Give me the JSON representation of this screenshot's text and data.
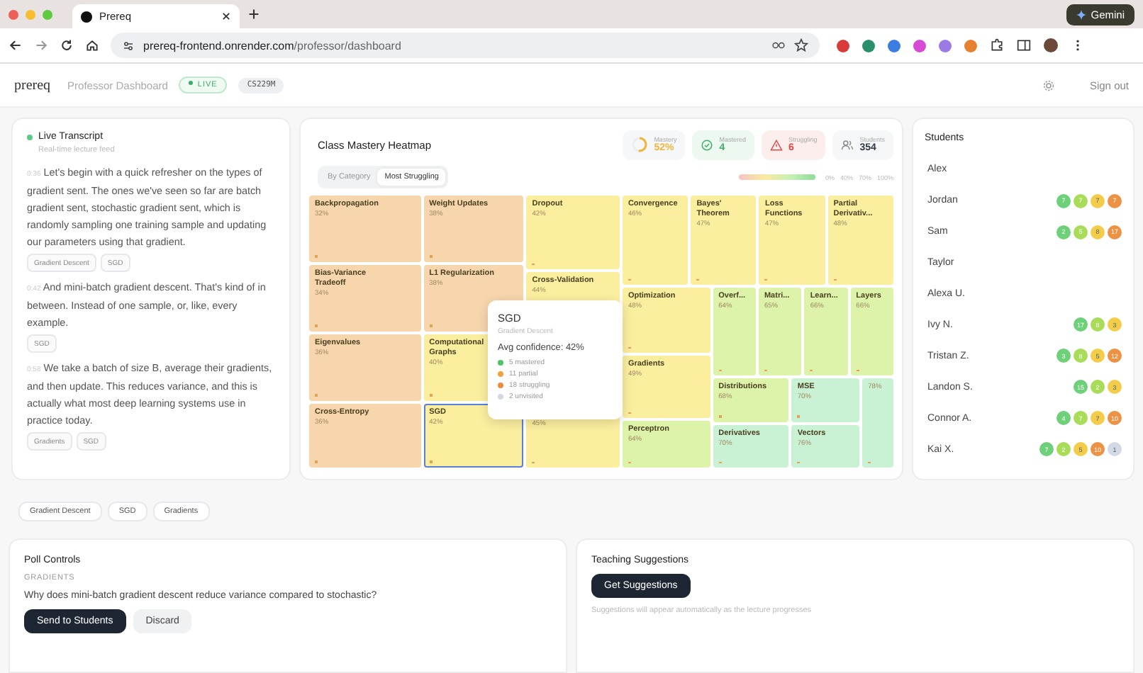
{
  "browser": {
    "tab_title": "Prereq",
    "url_domain": "prereq-frontend.onrender.com",
    "url_path": "/professor/dashboard",
    "gemini": "Gemini"
  },
  "header": {
    "logo": "prereq",
    "title": "Professor Dashboard",
    "live": "LIVE",
    "course": "CS229M",
    "sign_out": "Sign out"
  },
  "transcript": {
    "title": "Live Transcript",
    "subtitle": "Real-time lecture feed",
    "entries": [
      {
        "time": "0:36",
        "text": "Let's begin with a quick refresher on the types of gradient sent. The ones we've seen so far are batch gradient sent, stochastic gradient sent, which is randomly sampling one training sample and updating our parameters using that gradient.",
        "tags": [
          "Gradient Descent",
          "SGD"
        ]
      },
      {
        "time": "0:42",
        "text": "And mini-batch gradient descent. That's kind of in between. Instead of one sample, or, like, every example.",
        "tags": [
          "SGD"
        ]
      },
      {
        "time": "0:58",
        "text": "We take a batch of size B, average their gradients, and then update. This reduces variance, and this is actually what most deep learning systems use in practice today.",
        "tags": [
          "Gradients",
          "SGD"
        ]
      }
    ]
  },
  "heatmap": {
    "title": "Class Mastery Heatmap",
    "stats": [
      {
        "kind": "ring",
        "label": "Mastery",
        "value": "52%",
        "level": 0.52
      },
      {
        "kind": "mastered",
        "label": "Mastered",
        "value": "4"
      },
      {
        "kind": "struggling",
        "label": "Struggling",
        "value": "6"
      },
      {
        "kind": "students",
        "label": "Students",
        "value": "354"
      }
    ],
    "views": [
      {
        "label": "By Category",
        "selected": false
      },
      {
        "label": "Most Struggling",
        "selected": true
      }
    ],
    "legend": [
      "0%",
      "40%",
      "70%",
      "100%"
    ],
    "tiles": [
      {
        "name": "Backpropagation",
        "pct": "32%",
        "color": "#f7d5ad",
        "selected": false
      },
      {
        "name": "Bias-Variance Tradeoff",
        "pct": "34%",
        "color": "#f7d5ad",
        "selected": false
      },
      {
        "name": "Eigenvalues",
        "pct": "36%",
        "color": "#f7d5ad",
        "selected": false
      },
      {
        "name": "Cross-Entropy",
        "pct": "36%",
        "color": "#f7d5ad",
        "selected": false
      },
      {
        "name": "Weight Updates",
        "pct": "38%",
        "color": "#f7d5ad",
        "selected": false
      },
      {
        "name": "L1 Regularization",
        "pct": "38%",
        "color": "#f7d5ad",
        "selected": false
      },
      {
        "name": "Computational Graphs",
        "pct": "40%",
        "color": "#fbee9f",
        "selected": false
      },
      {
        "name": "SGD",
        "pct": "42%",
        "color": "#fbee9f",
        "selected": true
      },
      {
        "name": "Dropout",
        "pct": "42%",
        "color": "#fbee9f",
        "selected": false
      },
      {
        "name": "Cross-Validation",
        "pct": "44%",
        "color": "#fbee9f",
        "selected": false
      },
      {
        "pct": "45%",
        "color": "#fbee9f",
        "selected": false
      },
      {
        "name": "Convergence",
        "pct": "46%",
        "color": "#fbee9f",
        "selected": false
      },
      {
        "name": "Bayes' Theorem",
        "pct": "47%",
        "color": "#fbee9f",
        "selected": false
      },
      {
        "name": "Loss Functions",
        "pct": "47%",
        "color": "#fbee9f",
        "selected": false
      },
      {
        "name": "Partial Derivativ...",
        "pct": "48%",
        "color": "#fbee9f",
        "selected": false
      },
      {
        "name": "Optimization",
        "pct": "48%",
        "color": "#fbee9f",
        "selected": false
      },
      {
        "name": "Gradients",
        "pct": "49%",
        "color": "#fbee9f",
        "selected": false
      },
      {
        "name": "Perceptron",
        "pct": "64%",
        "color": "#ddf3aa",
        "selected": false
      },
      {
        "name": "Overf...",
        "pct": "64%",
        "color": "#ddf3aa",
        "selected": false
      },
      {
        "name": "Matri...",
        "pct": "65%",
        "color": "#ddf3aa",
        "selected": false
      },
      {
        "name": "Learn...",
        "pct": "66%",
        "color": "#ddf3aa",
        "selected": false
      },
      {
        "name": "Layers",
        "pct": "66%",
        "color": "#ddf3aa",
        "selected": false
      },
      {
        "name": "Distributions",
        "pct": "68%",
        "color": "#ddf3aa",
        "selected": false
      },
      {
        "name": "Derivatives",
        "pct": "70%",
        "color": "#c9f2d5",
        "selected": false
      },
      {
        "name": "MSE",
        "pct": "70%",
        "color": "#c9f2d5",
        "selected": false
      },
      {
        "name": "Vectors",
        "pct": "76%",
        "color": "#c9f2d5",
        "selected": false
      },
      {
        "pct": "78%",
        "color": "#c9f2d5",
        "selected": false
      }
    ],
    "tooltip": {
      "title": "SGD",
      "category": "Gradient Descent",
      "confidence": "Avg confidence: 42%",
      "items": [
        {
          "text": "5 mastered",
          "color": "#4cc463"
        },
        {
          "text": "11 partial",
          "color": "#f0a23c"
        },
        {
          "text": "18 struggling",
          "color": "#ee8a3a"
        },
        {
          "text": "2 unvisited",
          "color": "#d4d9e2"
        }
      ]
    }
  },
  "students": {
    "title": "Students",
    "rows": [
      {
        "name": "Alex",
        "badges": []
      },
      {
        "name": "Jordan",
        "badges": [
          {
            "text": "7",
            "color": "#6fd07a"
          },
          {
            "text": "7",
            "color": "#a9dc59"
          },
          {
            "text": "7",
            "color": "#f3cd4a"
          },
          {
            "text": "7",
            "color": "#ec9244"
          }
        ]
      },
      {
        "name": "Sam",
        "badges": [
          {
            "text": "2",
            "color": "#6fd07a"
          },
          {
            "text": "5",
            "color": "#a9dc59"
          },
          {
            "text": "8",
            "color": "#f3cd4a"
          },
          {
            "text": "17",
            "color": "#ec9244"
          }
        ]
      },
      {
        "name": "Taylor",
        "badges": []
      },
      {
        "name": "Alexa U.",
        "badges": []
      },
      {
        "name": "Ivy N.",
        "badges": [
          {
            "text": "17",
            "color": "#6fd07a"
          },
          {
            "text": "8",
            "color": "#a9dc59"
          },
          {
            "text": "3",
            "color": "#f3cd4a"
          }
        ]
      },
      {
        "name": "Tristan Z.",
        "badges": [
          {
            "text": "3",
            "color": "#6fd07a"
          },
          {
            "text": "8",
            "color": "#a9dc59"
          },
          {
            "text": "5",
            "color": "#f3cd4a"
          },
          {
            "text": "12",
            "color": "#ec9244"
          }
        ]
      },
      {
        "name": "Landon S.",
        "badges": [
          {
            "text": "15",
            "color": "#6fd07a"
          },
          {
            "text": "2",
            "color": "#a9dc59"
          },
          {
            "text": "3",
            "color": "#f3cd4a"
          }
        ]
      },
      {
        "name": "Connor A.",
        "badges": [
          {
            "text": "4",
            "color": "#6fd07a"
          },
          {
            "text": "7",
            "color": "#a9dc59"
          },
          {
            "text": "7",
            "color": "#f3cd4a"
          },
          {
            "text": "10",
            "color": "#ec9244"
          }
        ]
      },
      {
        "name": "Kai X.",
        "badges": [
          {
            "text": "7",
            "color": "#6fd07a"
          },
          {
            "text": "2",
            "color": "#a9dc59"
          },
          {
            "text": "5",
            "color": "#f3cd4a"
          },
          {
            "text": "10",
            "color": "#ec9244"
          },
          {
            "text": "1",
            "color": "#d3dae6"
          }
        ]
      }
    ]
  },
  "topic_tags": [
    "Gradient Descent",
    "SGD",
    "Gradients"
  ],
  "poll": {
    "title": "Poll Controls",
    "topic": "GRADIENTS",
    "question": "Why does mini-batch gradient descent reduce variance compared to stochastic?",
    "primary": "Send to Students",
    "secondary": "Discard"
  },
  "suggestions": {
    "title": "Teaching Suggestions",
    "button": "Get Suggestions",
    "note": "Suggestions will appear automatically as the lecture progresses"
  }
}
